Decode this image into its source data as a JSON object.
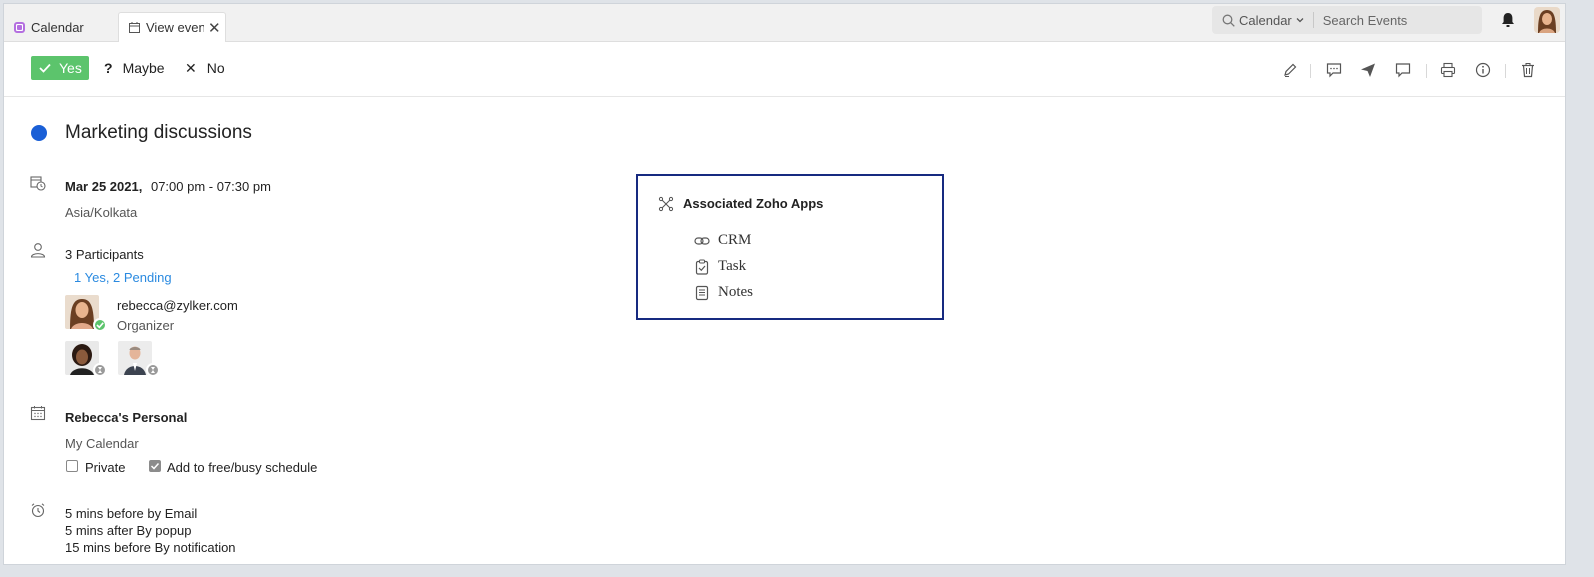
{
  "tabs": {
    "calendar": "Calendar",
    "view_event": "View event"
  },
  "search": {
    "scope": "Calendar",
    "placeholder": "Search Events"
  },
  "rsvp": {
    "yes": "Yes",
    "maybe": "Maybe",
    "no": "No"
  },
  "event": {
    "title": "Marketing discussions",
    "date": "Mar 25 2021,",
    "time": "07:00 pm - 07:30 pm",
    "timezone": "Asia/Kolkata",
    "participants_count": "3 Participants",
    "participants_status": "1 Yes, 2 Pending",
    "organizer_email": "rebecca@zylker.com",
    "organizer_role": "Organizer",
    "calendar_name": "Rebecca's Personal",
    "calendar_group": "My Calendar",
    "private_label": "Private",
    "freebusy_label": "Add to free/busy schedule",
    "reminders": [
      "5 mins before by Email",
      "5 mins after By popup",
      "15 mins before By notification"
    ]
  },
  "associated_apps": {
    "title": "Associated Zoho Apps",
    "items": [
      "CRM",
      "Task",
      "Notes"
    ]
  },
  "colors": {
    "accent_yes": "#5cc46c",
    "event_dot": "#1a5fd6",
    "link": "#2a8ae0",
    "apps_border": "#172a80"
  }
}
